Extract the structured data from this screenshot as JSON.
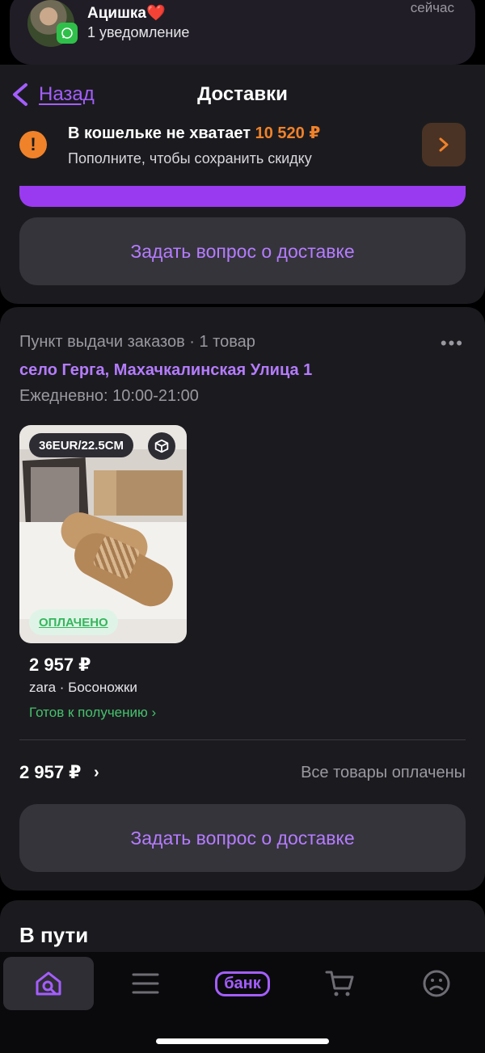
{
  "notification": {
    "sender": "Ацишка",
    "heart": "❤️",
    "text": "1 уведомление",
    "time": "сейчас"
  },
  "header": {
    "back_label": "Назад",
    "title": "Доставки"
  },
  "wallet": {
    "title": "В кошельке не хватает",
    "amount": "10 520 ₽",
    "subtitle": "Пополните, чтобы сохранить скидку"
  },
  "ask_button_label": "Задать вопрос о доставке",
  "pickup": {
    "type_line": "Пункт выдачи заказов · 1 товар",
    "menu_glyph": "•••",
    "address": "село Герга, Махачкалинская Улица 1",
    "hours": "Ежедневно: 10:00-21:00",
    "item": {
      "size": "36EUR/22.5CM",
      "status_badge": "ОПЛАЧЕНО",
      "price": "2 957 ₽",
      "name": "zara · Босоножки",
      "ready": "Готов к получению ›"
    },
    "total": "2 957 ₽",
    "total_chevron": "›",
    "paid_status": "Все товары оплачены"
  },
  "transit": {
    "title": "В пути"
  },
  "tabs": [
    {
      "icon": "home-search-icon",
      "active": true
    },
    {
      "icon": "menu-icon",
      "active": false
    },
    {
      "icon": "bank-icon",
      "label": "банк",
      "active": false
    },
    {
      "icon": "cart-icon",
      "active": false
    },
    {
      "icon": "profile-icon",
      "active": false
    }
  ],
  "colors": {
    "accent": "#a45eff",
    "warning": "#f0822a",
    "success": "#45c26d",
    "card": "#1b1b1f",
    "button": "#35343b"
  }
}
